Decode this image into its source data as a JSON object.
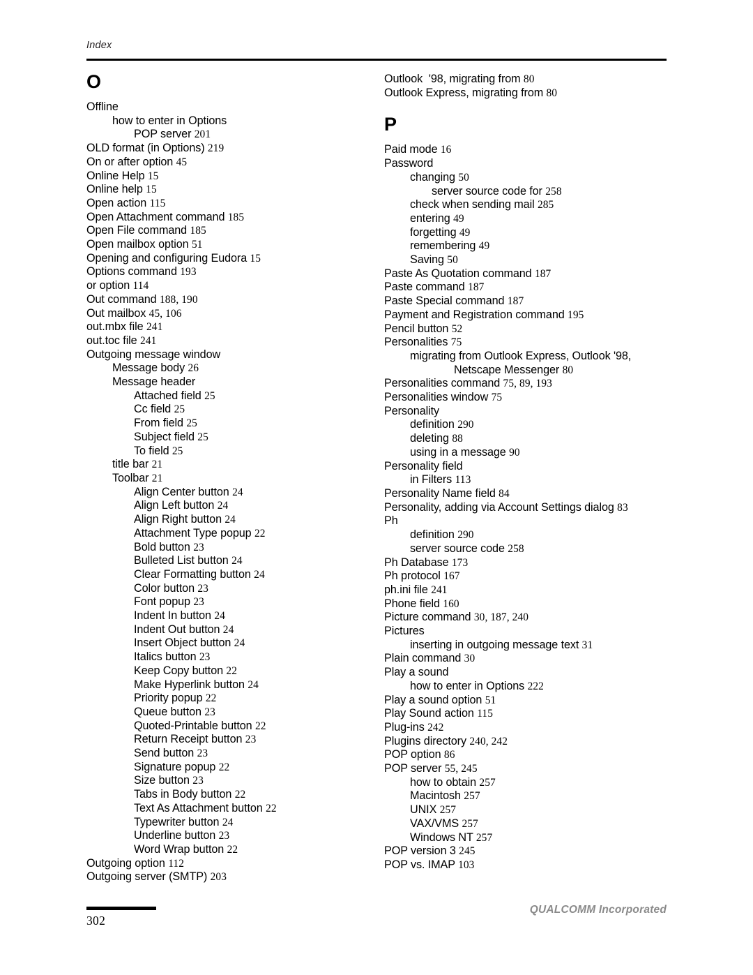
{
  "header": {
    "label": "Index"
  },
  "footer": {
    "page_number": "302",
    "company": "QUALCOMM Incorporated"
  },
  "columns": {
    "left": {
      "letter": "O",
      "entries": [
        {
          "level": 0,
          "text": "Offline",
          "pages": ""
        },
        {
          "level": 1,
          "text": "how to enter in Options",
          "pages": ""
        },
        {
          "level": 2,
          "text": "POP server ",
          "pages": "201"
        },
        {
          "level": 0,
          "text": "OLD format (in Options) ",
          "pages": "219"
        },
        {
          "level": 0,
          "text": "On or after option ",
          "pages": "45"
        },
        {
          "level": 0,
          "text": "Online Help ",
          "pages": "15"
        },
        {
          "level": 0,
          "text": "Online help ",
          "pages": "15"
        },
        {
          "level": 0,
          "text": "Open action ",
          "pages": "115"
        },
        {
          "level": 0,
          "text": "Open Attachment command ",
          "pages": "185"
        },
        {
          "level": 0,
          "text": "Open File command ",
          "pages": "185"
        },
        {
          "level": 0,
          "text": "Open mailbox option ",
          "pages": "51"
        },
        {
          "level": 0,
          "text": "Opening and configuring Eudora ",
          "pages": "15"
        },
        {
          "level": 0,
          "text": "Options command ",
          "pages": "193"
        },
        {
          "level": 0,
          "text": "or option ",
          "pages": "114"
        },
        {
          "level": 0,
          "text": "Out command ",
          "pages": "188, 190"
        },
        {
          "level": 0,
          "text": "Out mailbox ",
          "pages": "45, 106"
        },
        {
          "level": 0,
          "text": "out.mbx file ",
          "pages": "241"
        },
        {
          "level": 0,
          "text": "out.toc file ",
          "pages": "241"
        },
        {
          "level": 0,
          "text": "Outgoing message window",
          "pages": ""
        },
        {
          "level": 1,
          "text": "Message body ",
          "pages": "26"
        },
        {
          "level": 1,
          "text": "Message header",
          "pages": ""
        },
        {
          "level": 2,
          "text": "Attached field ",
          "pages": "25"
        },
        {
          "level": 2,
          "text": "Cc field ",
          "pages": "25"
        },
        {
          "level": 2,
          "text": "From field ",
          "pages": "25"
        },
        {
          "level": 2,
          "text": "Subject field ",
          "pages": "25"
        },
        {
          "level": 2,
          "text": "To field ",
          "pages": "25"
        },
        {
          "level": 1,
          "text": "title bar ",
          "pages": "21"
        },
        {
          "level": 1,
          "text": "Toolbar ",
          "pages": "21"
        },
        {
          "level": 2,
          "text": "Align Center button ",
          "pages": "24"
        },
        {
          "level": 2,
          "text": "Align Left button ",
          "pages": "24"
        },
        {
          "level": 2,
          "text": "Align Right button ",
          "pages": "24"
        },
        {
          "level": 2,
          "text": "Attachment Type popup ",
          "pages": "22"
        },
        {
          "level": 2,
          "text": "Bold button ",
          "pages": "23"
        },
        {
          "level": 2,
          "text": "Bulleted List button ",
          "pages": "24"
        },
        {
          "level": 2,
          "text": "Clear Formatting button ",
          "pages": "24"
        },
        {
          "level": 2,
          "text": "Color button ",
          "pages": "23"
        },
        {
          "level": 2,
          "text": "Font popup ",
          "pages": "23"
        },
        {
          "level": 2,
          "text": "Indent In button ",
          "pages": "24"
        },
        {
          "level": 2,
          "text": "Indent Out button ",
          "pages": "24"
        },
        {
          "level": 2,
          "text": "Insert Object button ",
          "pages": "24"
        },
        {
          "level": 2,
          "text": "Italics button ",
          "pages": "23"
        },
        {
          "level": 2,
          "text": "Keep Copy button ",
          "pages": "22"
        },
        {
          "level": 2,
          "text": "Make Hyperlink button ",
          "pages": "24"
        },
        {
          "level": 2,
          "text": "Priority popup ",
          "pages": "22"
        },
        {
          "level": 2,
          "text": "Queue button ",
          "pages": "23"
        },
        {
          "level": 2,
          "text": "Quoted-Printable button ",
          "pages": "22"
        },
        {
          "level": 2,
          "text": "Return Receipt button ",
          "pages": "23"
        },
        {
          "level": 2,
          "text": "Send button ",
          "pages": "23"
        },
        {
          "level": 2,
          "text": "Signature popup ",
          "pages": "22"
        },
        {
          "level": 2,
          "text": "Size button ",
          "pages": "23"
        },
        {
          "level": 2,
          "text": "Tabs in Body button ",
          "pages": "22"
        },
        {
          "level": 2,
          "text": "Text As Attachment button ",
          "pages": "22"
        },
        {
          "level": 2,
          "text": "Typewriter button ",
          "pages": "24"
        },
        {
          "level": 2,
          "text": "Underline button ",
          "pages": "23"
        },
        {
          "level": 2,
          "text": "Word Wrap button ",
          "pages": "22"
        },
        {
          "level": 0,
          "text": "Outgoing option ",
          "pages": "112"
        },
        {
          "level": 0,
          "text": "Outgoing server (SMTP) ",
          "pages": "203"
        }
      ]
    },
    "right": {
      "entries_before_letter": [
        {
          "level": 0,
          "text": "Outlook  '98, migrating from ",
          "pages": "80"
        },
        {
          "level": 0,
          "text": "Outlook Express, migrating from ",
          "pages": "80"
        }
      ],
      "letter": "P",
      "entries": [
        {
          "level": 0,
          "text": "Paid mode ",
          "pages": "16"
        },
        {
          "level": 0,
          "text": "Password",
          "pages": ""
        },
        {
          "level": 1,
          "text": "changing ",
          "pages": "50"
        },
        {
          "level": 2,
          "text": "server source code for ",
          "pages": "258"
        },
        {
          "level": 1,
          "text": "check when sending mail ",
          "pages": "285"
        },
        {
          "level": 1,
          "text": "entering ",
          "pages": "49"
        },
        {
          "level": 1,
          "text": "forgetting ",
          "pages": "49"
        },
        {
          "level": 1,
          "text": "remembering ",
          "pages": "49"
        },
        {
          "level": 1,
          "text": "Saving ",
          "pages": "50"
        },
        {
          "level": 0,
          "text": "Paste As Quotation command ",
          "pages": "187"
        },
        {
          "level": 0,
          "text": "Paste command ",
          "pages": "187"
        },
        {
          "level": 0,
          "text": "Paste Special command ",
          "pages": "187"
        },
        {
          "level": 0,
          "text": "Payment and Registration command ",
          "pages": "195"
        },
        {
          "level": 0,
          "text": "Pencil button ",
          "pages": "52"
        },
        {
          "level": 0,
          "text": "Personalities ",
          "pages": "75"
        },
        {
          "level": 1,
          "text": "migrating from Outlook Express, Outlook '98,",
          "pages": ""
        },
        {
          "level": 3,
          "text": "Netscape Messenger ",
          "pages": "80"
        },
        {
          "level": 0,
          "text": "Personalities command ",
          "pages": "75, 89, 193"
        },
        {
          "level": 0,
          "text": "Personalities window ",
          "pages": "75"
        },
        {
          "level": 0,
          "text": "Personality",
          "pages": ""
        },
        {
          "level": 1,
          "text": "definition ",
          "pages": "290"
        },
        {
          "level": 1,
          "text": "deleting ",
          "pages": "88"
        },
        {
          "level": 1,
          "text": "using in a message ",
          "pages": "90"
        },
        {
          "level": 0,
          "text": "Personality field",
          "pages": ""
        },
        {
          "level": 1,
          "text": "in Filters ",
          "pages": "113"
        },
        {
          "level": 0,
          "text": "Personality Name field ",
          "pages": "84"
        },
        {
          "level": 0,
          "text": "Personality, adding via Account Settings dialog ",
          "pages": "83"
        },
        {
          "level": 0,
          "text": "Ph",
          "pages": ""
        },
        {
          "level": 1,
          "text": "definition ",
          "pages": "290"
        },
        {
          "level": 1,
          "text": "server source code ",
          "pages": "258"
        },
        {
          "level": 0,
          "text": "Ph Database ",
          "pages": "173"
        },
        {
          "level": 0,
          "text": "Ph protocol ",
          "pages": "167"
        },
        {
          "level": 0,
          "text": "ph.ini file ",
          "pages": "241"
        },
        {
          "level": 0,
          "text": "Phone field ",
          "pages": "160"
        },
        {
          "level": 0,
          "text": "Picture command ",
          "pages": "30, 187, 240"
        },
        {
          "level": 0,
          "text": "Pictures",
          "pages": ""
        },
        {
          "level": 1,
          "text": "inserting in outgoing message text ",
          "pages": "31"
        },
        {
          "level": 0,
          "text": "Plain command ",
          "pages": "30"
        },
        {
          "level": 0,
          "text": "Play a sound",
          "pages": ""
        },
        {
          "level": 1,
          "text": "how to enter in Options ",
          "pages": "222"
        },
        {
          "level": 0,
          "text": "Play a sound option ",
          "pages": "51"
        },
        {
          "level": 0,
          "text": "Play Sound action ",
          "pages": "115"
        },
        {
          "level": 0,
          "text": "Plug-ins ",
          "pages": "242"
        },
        {
          "level": 0,
          "text": "Plugins directory ",
          "pages": "240, 242"
        },
        {
          "level": 0,
          "text": "POP option ",
          "pages": "86"
        },
        {
          "level": 0,
          "text": "POP server ",
          "pages": "55, 245"
        },
        {
          "level": 1,
          "text": "how to obtain ",
          "pages": "257"
        },
        {
          "level": 1,
          "text": "Macintosh ",
          "pages": "257"
        },
        {
          "level": 1,
          "text": "UNIX ",
          "pages": "257"
        },
        {
          "level": 1,
          "text": "VAX/VMS ",
          "pages": "257"
        },
        {
          "level": 1,
          "text": "Windows NT ",
          "pages": "257"
        },
        {
          "level": 0,
          "text": "POP version 3 ",
          "pages": "245"
        },
        {
          "level": 0,
          "text": "POP vs. IMAP ",
          "pages": "103"
        }
      ]
    }
  }
}
